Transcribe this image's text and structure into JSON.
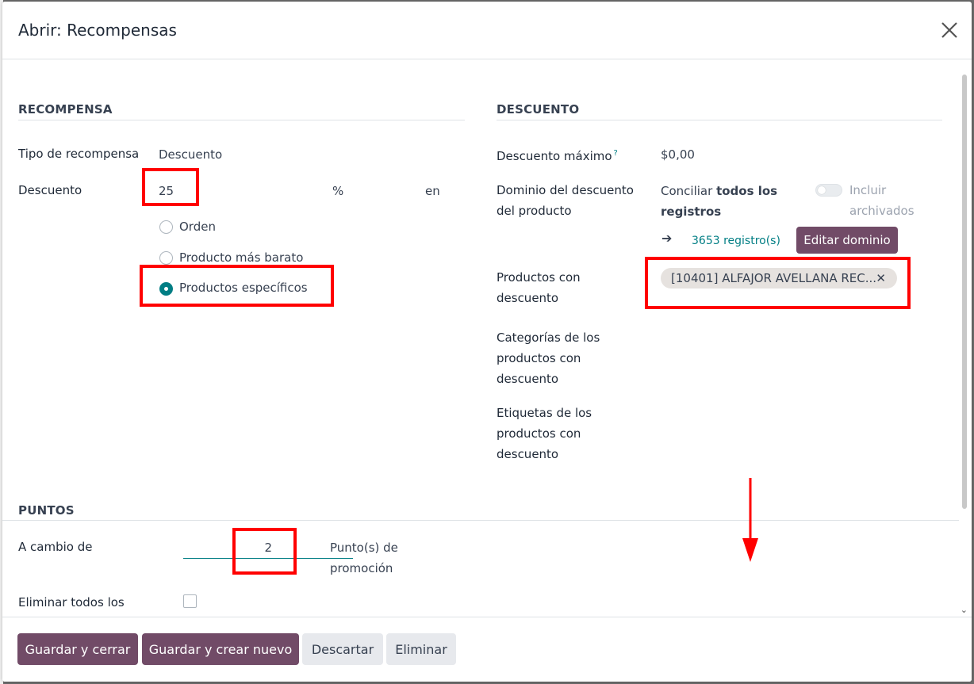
{
  "modal": {
    "title": "Abrir: Recompensas"
  },
  "reward": {
    "section_title": "RECOMPENSA",
    "type_label": "Tipo de recompensa",
    "type_value": "Descuento",
    "discount_label": "Descuento",
    "discount_value": "25",
    "discount_unit": "%",
    "discount_on": "en",
    "applies_options": [
      {
        "label": "Orden",
        "selected": false
      },
      {
        "label": "Producto más barato",
        "selected": false
      },
      {
        "label": "Productos específicos",
        "selected": true
      }
    ]
  },
  "discount": {
    "section_title": "DESCUENTO",
    "max_label": "Descuento máximo",
    "max_help": "?",
    "max_value": "$0,00",
    "domain_label_1": "Dominio del descuento",
    "domain_label_2": "del producto",
    "domain_match_prefix": "Conciliar",
    "domain_match_bold_1": "todos los",
    "domain_match_bold_2": "registros",
    "include_archived_1": "Incluir",
    "include_archived_2": "archivados",
    "records_link": "3653 registro(s)",
    "edit_domain_button": "Editar dominio",
    "products_label_1": "Productos con",
    "products_label_2": "descuento",
    "product_tag": "[10401] ALFAJOR AVELLANA REC...",
    "categories_label_1": "Categorías de los",
    "categories_label_2": "productos con",
    "categories_label_3": "descuento",
    "tags_label_1": "Etiquetas de los",
    "tags_label_2": "productos con",
    "tags_label_3": "descuento"
  },
  "points": {
    "section_title": "PUNTOS",
    "exchange_label": "A cambio de",
    "exchange_value": "2",
    "unit_1": "Punto(s) de",
    "unit_2": "promoción",
    "clear_label": "Eliminar todos los"
  },
  "footer": {
    "save_close": "Guardar y cerrar",
    "save_new": "Guardar y crear nuevo",
    "discard": "Descartar",
    "delete": "Eliminar"
  },
  "colors": {
    "primary": "#714b67",
    "accent": "#017e84",
    "highlight": "#ff0000"
  }
}
